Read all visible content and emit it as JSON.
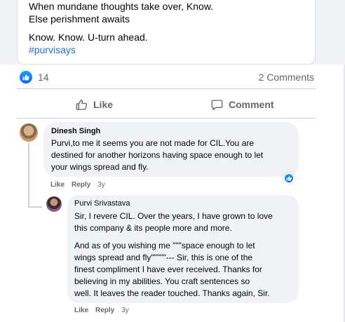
{
  "post": {
    "lines": [
      "When mundane thoughts take over, Know.",
      "Else perishment awaits",
      "Know. Know. U-turn ahead."
    ],
    "hashtag": "#purvisays"
  },
  "reactions": {
    "count": "14",
    "comments_count": "2 Comments",
    "colors": {
      "like_badge": "#0866ff",
      "hashtag": "#216fdb"
    }
  },
  "actions": {
    "like_label": "Like",
    "comment_label": "Comment"
  },
  "comments": [
    {
      "author": "Dinesh Singh",
      "lines": [
        "Purvi,to me it seems you are not made for CIL.You are",
        "destined for another horizons having space enough to let",
        "your wings spread and fly."
      ],
      "like_label": "Like",
      "reply_label": "Reply",
      "time": "3y",
      "reaction_icon": "like-icon"
    }
  ],
  "reply": {
    "author": "Purvi Srivastava",
    "para1": [
      "Sir, I revere CIL. Over the years, I have grown to love",
      "this company & its people more and more."
    ],
    "para2": [
      "And as of you wishing me \"\"\"space enough to let",
      "wings spread and fly\"\"\"\"\"--- Sir, this is one of the",
      "finest compliment I have ever received. Thanks for",
      "believing in my abilities. You craft sentences so",
      "well. It leaves the reader touched. Thanks again, Sir."
    ],
    "like_label": "Like",
    "reply_label": "Reply",
    "time": "3y"
  }
}
